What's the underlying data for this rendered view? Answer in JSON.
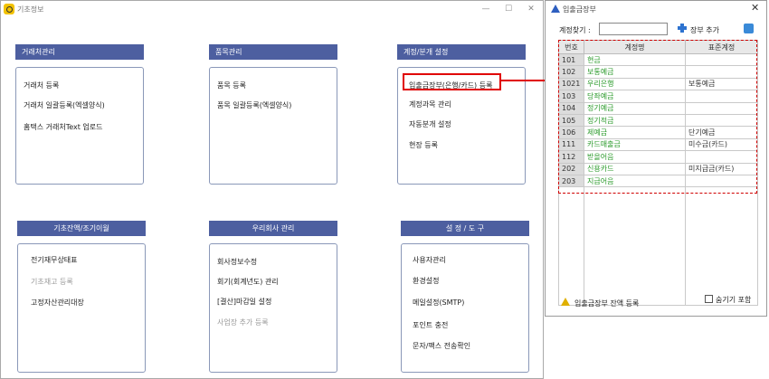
{
  "main_window": {
    "title": "기초정보",
    "controls": [
      "—",
      "☐",
      "✕"
    ]
  },
  "groups": [
    {
      "title": "거래처관리",
      "items": [
        {
          "label": "거래처 등록",
          "disabled": false
        },
        {
          "label": "거래처 일괄등록(엑셀양식)",
          "disabled": false
        },
        {
          "label": "홈택스 거래처Text 업로드",
          "disabled": false
        }
      ]
    },
    {
      "title": "품목관리",
      "items": [
        {
          "label": "품목 등록",
          "disabled": false
        },
        {
          "label": "품목 일괄등록(엑셀양식)",
          "disabled": false
        }
      ]
    },
    {
      "title": "계정/분개 설정",
      "items": [
        {
          "label": "입출금장부(은행/카드) 등록",
          "disabled": false
        },
        {
          "label": "계정과목 관리",
          "disabled": false
        },
        {
          "label": "자동분개 설정",
          "disabled": false
        },
        {
          "label": "현장 등록",
          "disabled": false
        }
      ]
    },
    {
      "title": "기초잔액/조기이월",
      "items": [
        {
          "label": "전기재무상태표",
          "disabled": false
        },
        {
          "label": "기초재고 등록",
          "disabled": true
        },
        {
          "label": "고정자산관리대장",
          "disabled": false
        }
      ]
    },
    {
      "title": "우리회사 관리",
      "items": [
        {
          "label": "회사정보수정",
          "disabled": false
        },
        {
          "label": "회기(회계년도) 관리",
          "disabled": false
        },
        {
          "label": "[결산]마감일 설정",
          "disabled": false
        },
        {
          "label": "사업장 추가 등록",
          "disabled": true
        }
      ]
    },
    {
      "title": "설 정 / 도 구",
      "items": [
        {
          "label": "사용자관리",
          "disabled": false
        },
        {
          "label": "환경설정",
          "disabled": false
        },
        {
          "label": "메일설정(SMTP)",
          "disabled": false
        },
        {
          "label": "포인트 충전",
          "disabled": false
        },
        {
          "label": "문자/팩스 전송확인",
          "disabled": false
        }
      ]
    }
  ],
  "side_window": {
    "title": "입출금장부",
    "close": "✕",
    "search_label": "계정찾기 :",
    "search_value": "",
    "add_label": "장부 추가",
    "columns": [
      "번호",
      "계정명",
      "표준계정"
    ],
    "rows": [
      {
        "no": "101",
        "name": "현금",
        "std": ""
      },
      {
        "no": "102",
        "name": "보통예금",
        "std": ""
      },
      {
        "no": "1021",
        "name": "우리은행",
        "std": "보통예금"
      },
      {
        "no": "103",
        "name": "당좌예금",
        "std": ""
      },
      {
        "no": "104",
        "name": "정기예금",
        "std": ""
      },
      {
        "no": "105",
        "name": "정기적금",
        "std": ""
      },
      {
        "no": "106",
        "name": "제예금",
        "std": "단기예금"
      },
      {
        "no": "111",
        "name": "카드매출금",
        "std": "미수금(카드)"
      },
      {
        "no": "112",
        "name": "받을어음",
        "std": ""
      },
      {
        "no": "202",
        "name": "신용카드",
        "std": "미지급금(카드)"
      },
      {
        "no": "203",
        "name": "지급어음",
        "std": ""
      }
    ],
    "balance_label": "입출금장부 잔액 등록",
    "hide_label": "숨기기 포함"
  },
  "colors": {
    "group_header": "#4d5fa0",
    "highlight": "#e00000",
    "account_name": "#2a9a2a"
  }
}
